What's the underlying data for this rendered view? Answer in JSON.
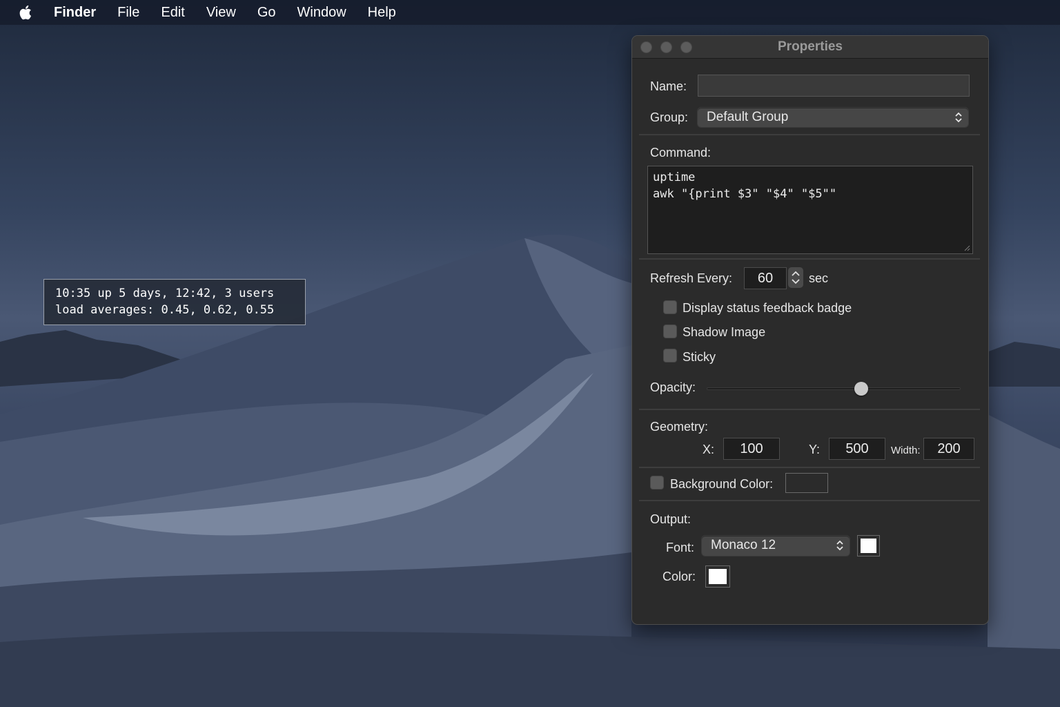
{
  "menubar": {
    "apple_icon": "apple-logo-icon",
    "app_name": "Finder",
    "items": [
      "File",
      "Edit",
      "View",
      "Go",
      "Window",
      "Help"
    ]
  },
  "widget": {
    "lines": [
      "10:35 up 5 days, 12:42, 3 users",
      "load averages: 0.45, 0.62, 0.55"
    ]
  },
  "window": {
    "title": "Properties",
    "name_label": "Name:",
    "name_value": "",
    "group_label": "Group:",
    "group_value": "Default Group",
    "command_label": "Command:",
    "command_lines": [
      "uptime",
      "awk \"{print $3\" \"$4\" \"$5\"\""
    ],
    "refresh_label": "Refresh Every:",
    "refresh_value": "60",
    "refresh_unit": "sec",
    "checkboxes": [
      {
        "label": "Display status feedback badge",
        "checked": false
      },
      {
        "label": "Shadow Image",
        "checked": false
      },
      {
        "label": "Sticky",
        "checked": false
      }
    ],
    "opacity_label": "Opacity:",
    "opacity_value": 0.61,
    "geometry_label": "Geometry:",
    "x_label": "X:",
    "x_value": "100",
    "y_label": "Y:",
    "y_value": "500",
    "width_label": "Width:",
    "width_value": "200",
    "background_label": "Background Color:",
    "background_checked": false,
    "background_color": "#2b2b2b",
    "output_label": "Output:",
    "font_label": "Font:",
    "font_value": "Monaco 12",
    "font_color": "#ffffff",
    "color_label": "Color:",
    "color_value": "#ffffff"
  }
}
